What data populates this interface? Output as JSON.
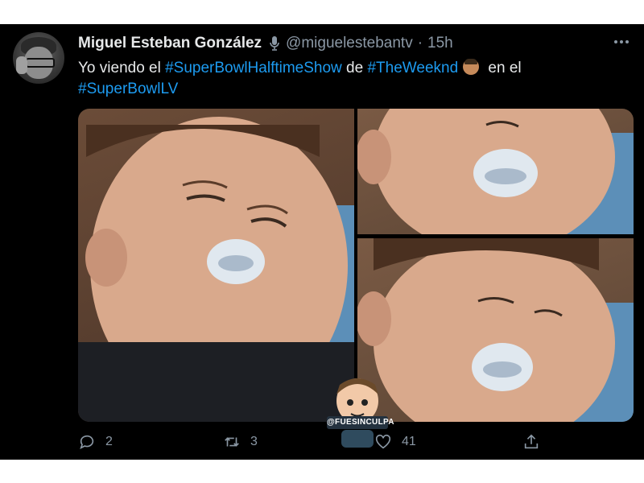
{
  "tweet": {
    "author": {
      "display_name": "Miguel Esteban González",
      "handle": "@miguelestebantv",
      "separator": "·",
      "time": "15h",
      "badge_icon": "microphone-icon",
      "avatar": "avatar-photo"
    },
    "text": {
      "part1": "Yo viendo el ",
      "hashtag1": "#SuperBowlHalftimeShow",
      "part2": " de ",
      "hashtag2": "#TheWeeknd",
      "emoji": "man-face-emoji",
      "part3": " en el",
      "hashtag3": "#SuperBowlLV"
    },
    "media": {
      "photos": [
        "toddler-with-pacifier-eyes-half-open",
        "toddler-with-pacifier-eyes-closing",
        "toddler-with-pacifier-asleep"
      ],
      "watermark": "@FUESINCULPA"
    },
    "actions": {
      "reply": {
        "icon": "reply-icon",
        "count": "2"
      },
      "retweet": {
        "icon": "retweet-icon",
        "count": "3"
      },
      "like": {
        "icon": "heart-icon",
        "count": "41"
      },
      "share": {
        "icon": "share-icon"
      }
    },
    "more_icon": "more-options-icon"
  },
  "colors": {
    "background": "#000000",
    "text": "#e7e9ea",
    "muted": "#8b98a5",
    "hashtag": "#1d9bf0"
  }
}
